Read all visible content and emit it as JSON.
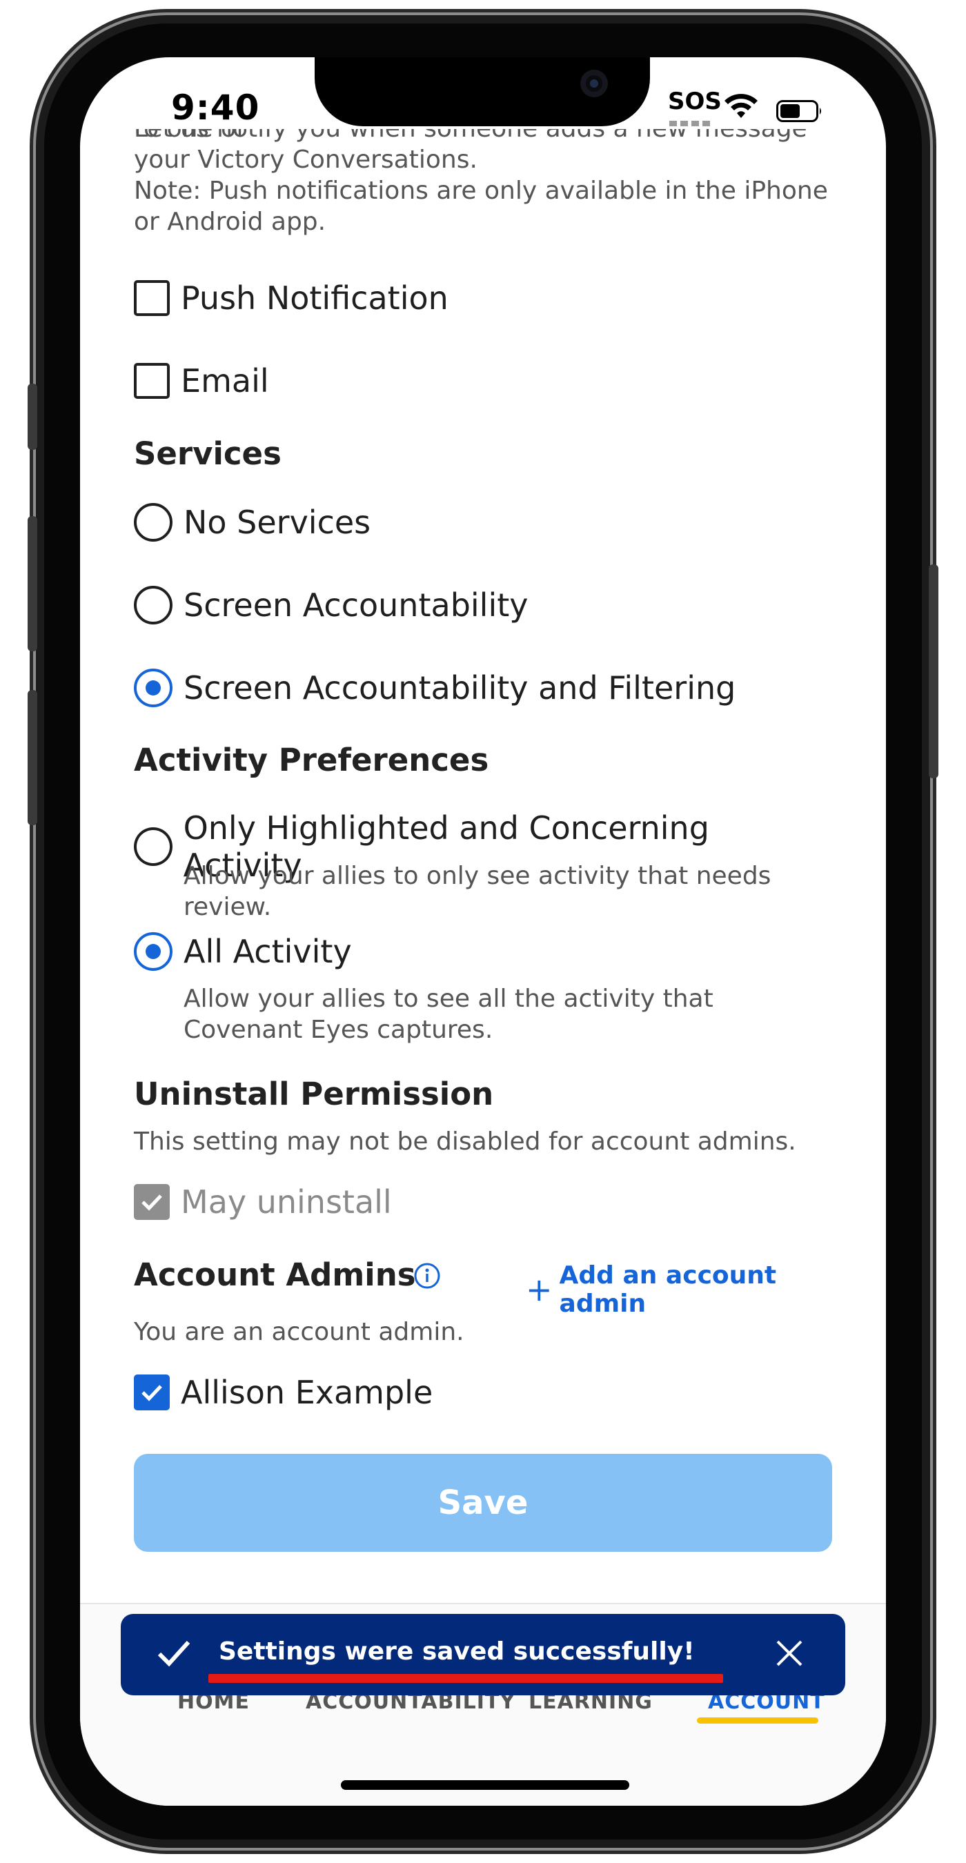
{
  "status_bar": {
    "time": "9:40",
    "carrier": "SOS"
  },
  "intro": {
    "clipped_line": "Let us notify you when someone adds a new message to one of",
    "line2": "your Victory Conversations.",
    "note": "Note: Push notifications are only available in the iPhone or Android app."
  },
  "notifications": {
    "push": {
      "label": "Push Notification",
      "checked": false
    },
    "email": {
      "label": "Email",
      "checked": false
    }
  },
  "services": {
    "title": "Services",
    "options": [
      {
        "label": "No Services",
        "selected": false
      },
      {
        "label": "Screen Accountability",
        "selected": false
      },
      {
        "label": "Screen Accountability and Filtering",
        "selected": true
      }
    ]
  },
  "activity": {
    "title": "Activity Preferences",
    "options": [
      {
        "label": "Only Highlighted and Concerning Activity",
        "description": "Allow your allies to only see activity that needs review.",
        "selected": false
      },
      {
        "label": "All Activity",
        "description": "Allow your allies to see all the activity that Covenant Eyes captures.",
        "selected": true
      }
    ]
  },
  "uninstall": {
    "title": "Uninstall Permission",
    "note": "This setting may not be disabled for account admins.",
    "checkbox_label": "May uninstall",
    "checked": true,
    "disabled": true
  },
  "admins": {
    "title": "Account Admins",
    "add_label": "Add an account admin",
    "note": "You are an account admin.",
    "members": [
      {
        "name": "Allison Example",
        "checked": true
      }
    ]
  },
  "save_label": "Save",
  "toast": {
    "message": "Settings were saved successfully!"
  },
  "nav": {
    "items": [
      "HOME",
      "ACCOUNTABILITY",
      "LEARNING",
      "ACCOUNT"
    ],
    "active": "ACCOUNT"
  },
  "colors": {
    "accent": "#1565d8",
    "save_button": "#85c1f4",
    "toast_bg": "#03297a",
    "nav_underline": "#f7c300",
    "annotation_underline": "#e41b17"
  }
}
